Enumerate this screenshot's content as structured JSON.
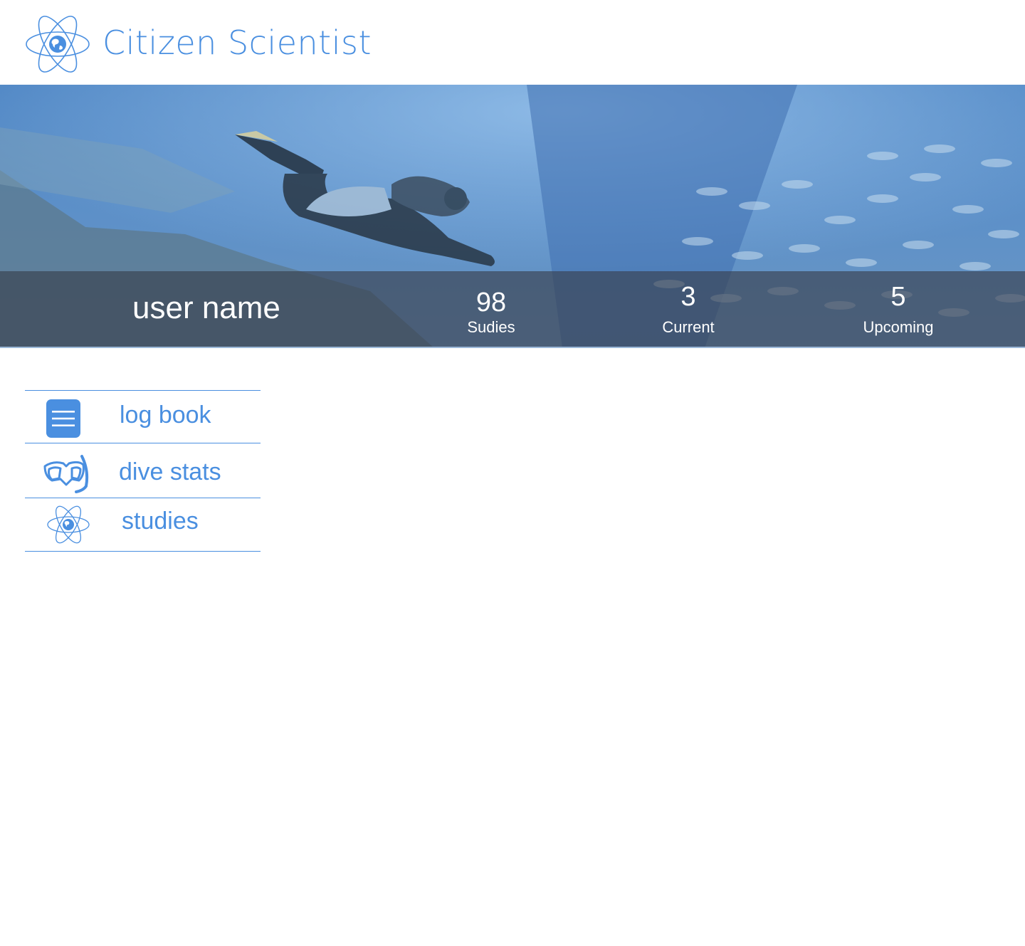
{
  "app": {
    "brand_name": "Citizen Scientist",
    "logo_icon": "atom-globe-icon",
    "accent_color": "#4a8fe0"
  },
  "profile": {
    "user_name": "user name",
    "stats": [
      {
        "value": "98",
        "label": "Sudies"
      },
      {
        "value": "3",
        "label": "Current"
      },
      {
        "value": "5",
        "label": "Upcoming"
      }
    ]
  },
  "nav": {
    "items": [
      {
        "label": "log book",
        "icon": "menu-list-icon"
      },
      {
        "label": "dive stats",
        "icon": "dive-mask-snorkel-icon"
      },
      {
        "label": "studies",
        "icon": "atom-globe-icon"
      }
    ]
  }
}
